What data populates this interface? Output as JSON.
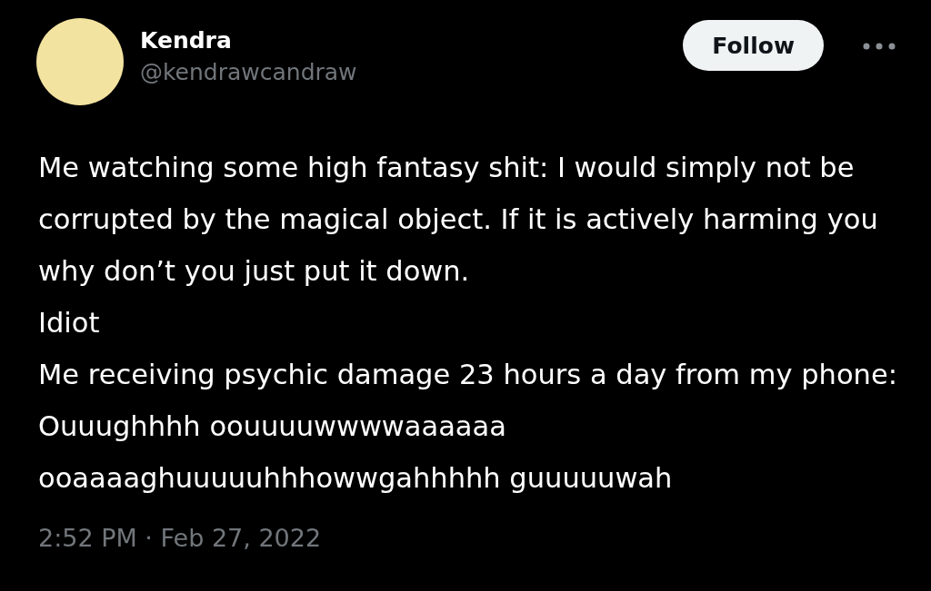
{
  "author": {
    "name": "Kendra",
    "handle": "@kendrawcandraw"
  },
  "follow_button": {
    "label": "Follow"
  },
  "tweet": {
    "text": "Me watching some high fantasy shit: I would simply not be corrupted by the magical object. If it is actively harming you why don’t you just put it down.\nIdiot\nMe receiving psychic damage 23 hours a day from my phone: Ouuughhhh oouuuuwwwwaaaaaa ooaaaaghuuuuuhhhowwgahhhhh guuuuuwah",
    "timestamp": "2:52 PM · Feb 27, 2022"
  }
}
